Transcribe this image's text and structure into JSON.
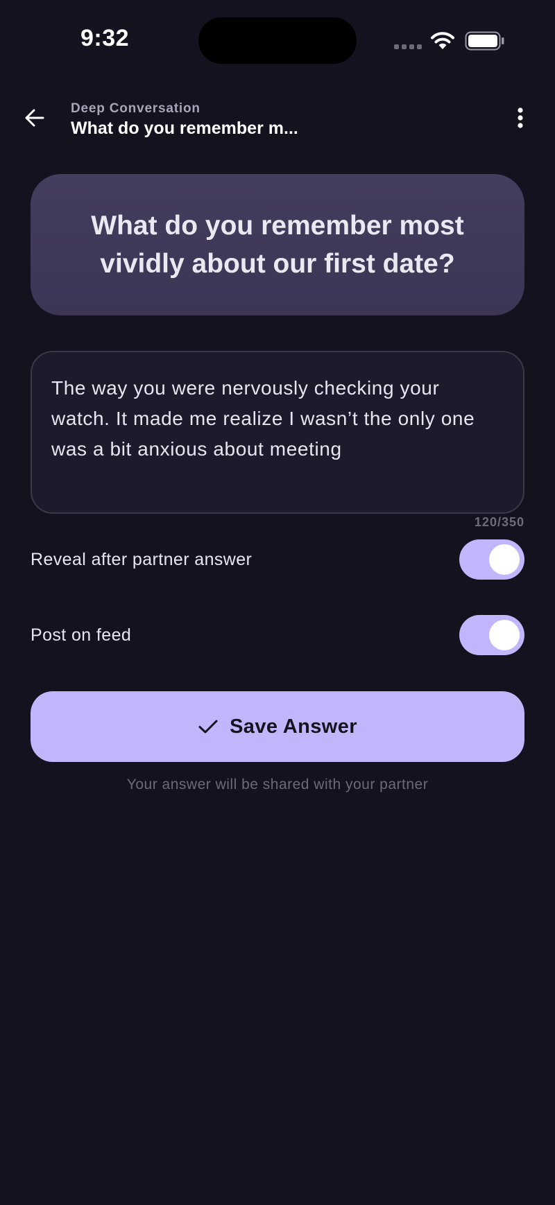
{
  "status_bar": {
    "time": "9:32"
  },
  "header": {
    "subtitle": "Deep Conversation",
    "title": "What do you remember m..."
  },
  "question": {
    "text": "What do you remember most vividly about our first date?"
  },
  "answer": {
    "value": "The way you were nervously checking your watch. It made me realize I wasn’t the only one was a bit anxious about meeting",
    "counter": "120/350"
  },
  "toggles": [
    {
      "label": "Reveal after partner answer",
      "on": true
    },
    {
      "label": "Post on feed",
      "on": true
    }
  ],
  "save_button": {
    "label": "Save Answer"
  },
  "footnote": "Your answer will be shared with your partner",
  "colors": {
    "background": "#14121f",
    "accent": "#c1b6fb",
    "card": "#443d5e"
  }
}
